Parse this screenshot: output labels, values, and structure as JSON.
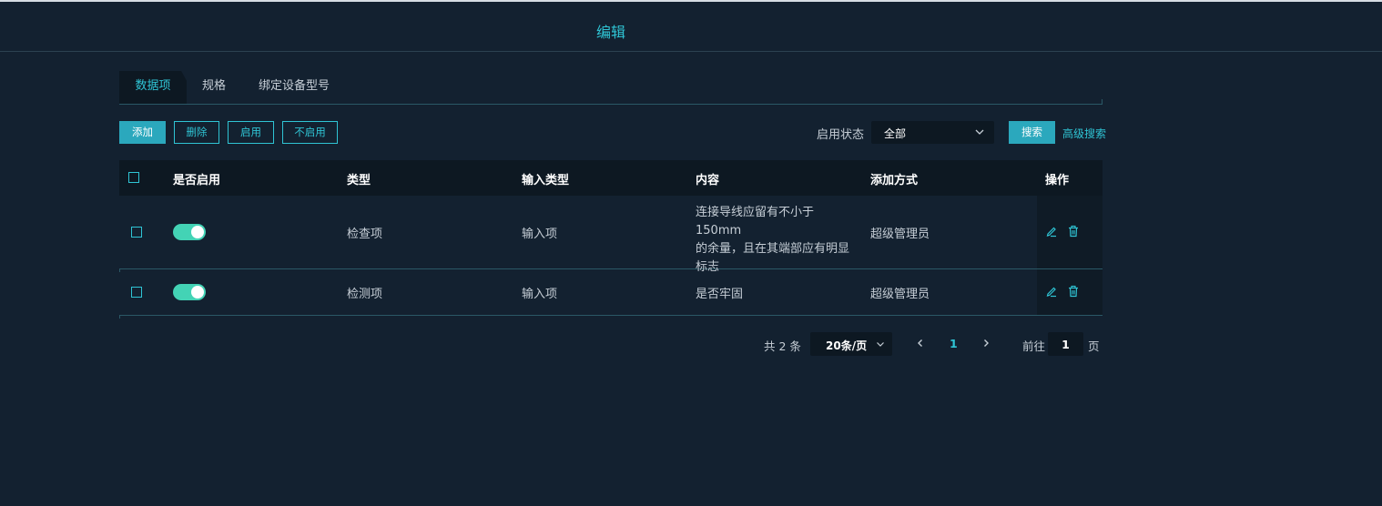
{
  "header": {
    "title": "编辑"
  },
  "tabs": [
    {
      "label": "数据项",
      "active": true
    },
    {
      "label": "规格",
      "active": false
    },
    {
      "label": "绑定设备型号",
      "active": false
    }
  ],
  "toolbar": {
    "add_label": "添加",
    "delete_label": "删除",
    "enable_label": "启用",
    "disable_label": "不启用",
    "status_filter_label": "启用状态",
    "status_filter_value": "全部",
    "search_label": "搜索",
    "advanced_search_label": "高级搜索"
  },
  "table": {
    "columns": [
      "是否启用",
      "类型",
      "输入类型",
      "内容",
      "添加方式",
      "操作"
    ],
    "rows": [
      {
        "enabled": true,
        "type": "检查项",
        "input_type": "输入项",
        "content_lines": [
          "连接导线应留有不小于150mm",
          "的余量，且在其端部应有明显",
          "标志"
        ],
        "added_by": "超级管理员"
      },
      {
        "enabled": true,
        "type": "检测项",
        "input_type": "输入项",
        "content": "是否牢固",
        "added_by": "超级管理员"
      }
    ]
  },
  "pagination": {
    "total_text": "共 2 条",
    "page_size": "20条/页",
    "current_page": "1",
    "goto_label": "前往",
    "goto_value": "1",
    "goto_unit": "页"
  },
  "colors": {
    "background": "#132130",
    "accent": "#2fc4d4",
    "switch_on": "#43d3b5",
    "header_bg": "#0d1822"
  },
  "icons": {
    "edit": "pencil-icon",
    "delete": "trash-icon",
    "dropdown": "chevron-down-icon",
    "prev": "chevron-left-icon",
    "next": "chevron-right-icon"
  }
}
